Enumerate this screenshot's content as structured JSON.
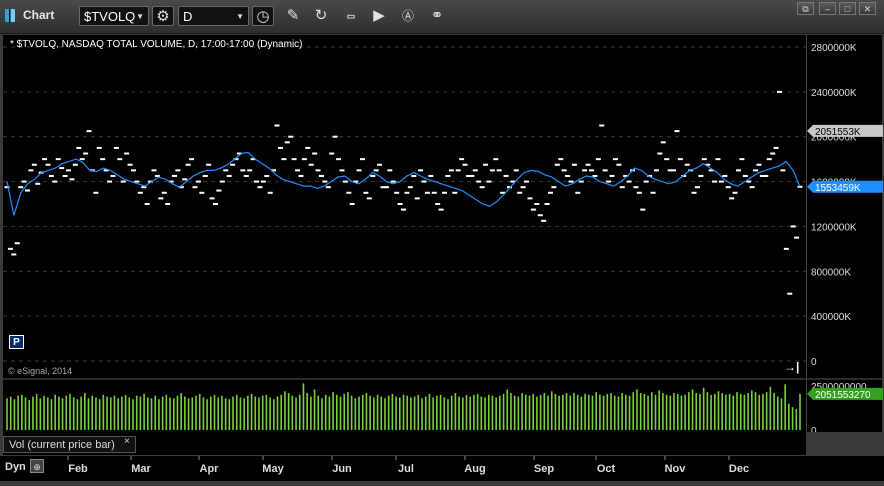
{
  "toolbar": {
    "app_title": "Chart",
    "symbol_value": "$TVOLQ",
    "interval_value": "D"
  },
  "chart_header": {
    "legend": "* $TVOLQ, NASDAQ TOTAL VOLUME, D, 17:00-17:00 (Dynamic)",
    "copyright": "© eSignal, 2014",
    "p_button": "P",
    "end_button": "→|"
  },
  "volume_study": {
    "label": "Vol (current price bar)",
    "close_label": "×"
  },
  "time_axis": {
    "dyn_label": "Dyn",
    "months": [
      "Feb",
      "Mar",
      "Apr",
      "May",
      "Jun",
      "Jul",
      "Aug",
      "Sep",
      "Oct",
      "Nov",
      "Dec"
    ]
  },
  "colors": {
    "background": "#000000",
    "price_marks": "#ffffff",
    "moving_average": "#1e90ff",
    "volume_bars": "#7cd03c",
    "last_price_tag": "#1e8fff",
    "ma_tag": "#c8c8c8",
    "volume_tag": "#33a020"
  },
  "chart_data": [
    {
      "type": "scatter",
      "title": "$TVOLQ, NASDAQ TOTAL VOLUME, D",
      "price_axis_ticks": [
        "2800000K",
        "2400000K",
        "2000000K",
        "1600000K",
        "1200000K",
        "800000K",
        "400000K",
        "0"
      ],
      "ylim": [
        0,
        2800000
      ],
      "grid": true,
      "last_value_tag": "1553459K",
      "ma_value_tag": "2051553K",
      "series": [
        {
          "values": [
            1550000,
            1000000,
            950000,
            1050000,
            1550000,
            1600000,
            1520000,
            1700000,
            1750000,
            1580000,
            1680000,
            1800000,
            1750000,
            1650000,
            1600000,
            1800000,
            1720000,
            1650000,
            1700000,
            1620000,
            1750000,
            1900000,
            1800000,
            1850000,
            2050000,
            1700000,
            1500000,
            1900000,
            1800000,
            1700000,
            1600000,
            1650000,
            1900000,
            1800000,
            1600000,
            1850000,
            1750000,
            1700000,
            1600000,
            1500000,
            1550000,
            1400000,
            1600000,
            1700000,
            1650000,
            1450000,
            1500000,
            1400000,
            1600000,
            1650000,
            1700000,
            1550000,
            1620000,
            1750000,
            1800000,
            1550000,
            1600000,
            1500000,
            1650000,
            1750000,
            1450000,
            1400000,
            1520000,
            1600000,
            1700000,
            1650000,
            1750000,
            1800000,
            1850000,
            1700000,
            1650000,
            1700000,
            1800000,
            1600000,
            1550000,
            1600000,
            1650000,
            1500000,
            1700000,
            2100000,
            1900000,
            1800000,
            1950000,
            2000000,
            1800000,
            1700000,
            1650000,
            1800000,
            1900000,
            1750000,
            1850000,
            1700000,
            1650000,
            1600000,
            1550000,
            1850000,
            2000000,
            1800000,
            1700000,
            1600000,
            1500000,
            1400000,
            1600000,
            1700000,
            1800000,
            1500000,
            1450000,
            1650000,
            1700000,
            1750000,
            1550000,
            1550000,
            1700000,
            1600000,
            1500000,
            1400000,
            1350000,
            1500000,
            1550000,
            1650000,
            1450000,
            1700000,
            1600000,
            1500000,
            1650000,
            1500000,
            1400000,
            1350000,
            1500000,
            1650000,
            1700000,
            1500000,
            1700000,
            1800000,
            1750000,
            1650000,
            1650000,
            1700000,
            1600000,
            1550000,
            1750000,
            1600000,
            1700000,
            1800000,
            1700000,
            1500000,
            1650000,
            1550000,
            1600000,
            1700000,
            1500000,
            1550000,
            1600000,
            1450000,
            1350000,
            1400000,
            1300000,
            1250000,
            1400000,
            1500000,
            1550000,
            1750000,
            1800000,
            1700000,
            1650000,
            1600000,
            1750000,
            1500000,
            1600000,
            1700000,
            1750000,
            1700000,
            1650000,
            1800000,
            2100000,
            1700000,
            1600000,
            1650000,
            1800000,
            1750000,
            1550000,
            1650000,
            1600000,
            1700000,
            1550000,
            1500000,
            1350000,
            1600000,
            1650000,
            1500000,
            1700000,
            1850000,
            1950000,
            1800000,
            1700000,
            1700000,
            2050000,
            1800000,
            1650000,
            1750000,
            1700000,
            1500000,
            1550000,
            1650000,
            1800000,
            1750000,
            1700000,
            1600000,
            1800000,
            1600000,
            1650000,
            1550000,
            1450000,
            1500000,
            1700000,
            1800000,
            1650000,
            1600000,
            1550000,
            1700000,
            1750000,
            1650000,
            1650000,
            1800000,
            1850000,
            1900000,
            2400000,
            1700000,
            1000000,
            600000,
            1200000,
            1100000,
            1553459
          ]
        },
        {
          "name": "Moving average",
          "values": [
            1600000,
            1300000,
            1500000,
            1580000,
            1620000,
            1680000,
            1700000,
            1720000,
            1760000,
            1780000,
            1800000,
            1770000,
            1700000,
            1690000,
            1720000,
            1700000,
            1660000,
            1620000,
            1600000,
            1580000,
            1560000,
            1600000,
            1640000,
            1620000,
            1580000,
            1550000,
            1600000,
            1650000,
            1680000,
            1700000,
            1700000,
            1720000,
            1750000,
            1800000,
            1850000,
            1860000,
            1800000,
            1760000,
            1720000,
            1660000,
            1620000,
            1600000,
            1580000,
            1560000,
            1560000,
            1540000,
            1560000,
            1600000,
            1640000,
            1650000,
            1600000,
            1580000,
            1620000,
            1680000,
            1650000,
            1600000,
            1580000,
            1600000,
            1650000,
            1680000,
            1650000,
            1620000,
            1600000,
            1580000,
            1560000,
            1540000,
            1520000,
            1480000,
            1440000,
            1400000,
            1380000,
            1420000,
            1480000,
            1550000,
            1620000,
            1680000,
            1700000,
            1690000,
            1660000,
            1640000,
            1600000,
            1560000,
            1580000,
            1620000,
            1650000,
            1640000,
            1600000,
            1580000,
            1560000,
            1600000,
            1650000,
            1720000,
            1700000,
            1650000,
            1620000,
            1600000,
            1580000,
            1600000,
            1650000,
            1700000,
            1720000,
            1760000,
            1720000,
            1680000,
            1620000,
            1580000,
            1560000,
            1600000,
            1640000,
            1680000,
            1700000,
            1720000,
            1740000,
            1780000,
            1700000,
            1553459
          ]
        }
      ]
    },
    {
      "type": "bar",
      "title": "Vol (current price bar)",
      "axis_ticks": [
        "2500000000",
        "0"
      ],
      "ylim": [
        0,
        2500000000
      ],
      "last_value_tag": "2051553270",
      "values": [
        1800000000,
        1900000000,
        1750000000,
        1950000000,
        2000000000,
        1850000000,
        1700000000,
        1900000000,
        2050000000,
        1800000000,
        1950000000,
        1850000000,
        1750000000,
        2000000000,
        1900000000,
        1800000000,
        1950000000,
        2050000000,
        1850000000,
        1750000000,
        1900000000,
        2100000000,
        1800000000,
        1950000000,
        1850000000,
        1750000000,
        2000000000,
        1900000000,
        1850000000,
        1950000000,
        1800000000,
        1900000000,
        2000000000,
        1850000000,
        1750000000,
        1950000000,
        1900000000,
        2050000000,
        1850000000,
        1800000000,
        1950000000,
        1750000000,
        1900000000,
        2000000000,
        1850000000,
        1800000000,
        1950000000,
        2100000000,
        1900000000,
        1800000000,
        1850000000,
        1950000000,
        2050000000,
        1850000000,
        1750000000,
        1900000000,
        2000000000,
        1850000000,
        1950000000,
        1800000000,
        1750000000,
        1900000000,
        2000000000,
        1850000000,
        1800000000,
        1950000000,
        2050000000,
        1900000000,
        1850000000,
        1950000000,
        2000000000,
        1850000000,
        1750000000,
        1900000000,
        2000000000,
        2200000000,
        2100000000,
        1950000000,
        1850000000,
        2000000000,
        2650000000,
        2100000000,
        1900000000,
        2300000000,
        1950000000,
        1800000000,
        2000000000,
        1900000000,
        2150000000,
        2000000000,
        1900000000,
        2050000000,
        2150000000,
        1950000000,
        1800000000,
        1900000000,
        2000000000,
        2100000000,
        1950000000,
        1850000000,
        2000000000,
        1900000000,
        1800000000,
        1950000000,
        2050000000,
        1900000000,
        1850000000,
        2000000000,
        1950000000,
        1850000000,
        1900000000,
        2000000000,
        1800000000,
        1900000000,
        2050000000,
        1850000000,
        1950000000,
        2000000000,
        1850000000,
        1750000000,
        1950000000,
        2100000000,
        1900000000,
        1850000000,
        2000000000,
        1900000000,
        2000000000,
        2050000000,
        1900000000,
        1850000000,
        2000000000,
        1950000000,
        1850000000,
        1950000000,
        2050000000,
        2300000000,
        2100000000,
        1950000000,
        1900000000,
        2100000000,
        2000000000,
        1950000000,
        2050000000,
        1900000000,
        2000000000,
        2100000000,
        1950000000,
        2200000000,
        2050000000,
        1950000000,
        2000000000,
        2100000000,
        1950000000,
        2100000000,
        2000000000,
        1900000000,
        2050000000,
        2000000000,
        1950000000,
        2150000000,
        2000000000,
        1950000000,
        2050000000,
        2100000000,
        1950000000,
        1900000000,
        2100000000,
        2000000000,
        1950000000,
        2150000000,
        2300000000,
        2100000000,
        2050000000,
        1950000000,
        2150000000,
        2000000000,
        2250000000,
        2100000000,
        2000000000,
        1950000000,
        2100000000,
        2050000000,
        1950000000,
        2000000000,
        2150000000,
        2300000000,
        2100000000,
        2050000000,
        2400000000,
        2150000000,
        2000000000,
        2050000000,
        2200000000,
        2100000000,
        2000000000,
        2050000000,
        1950000000,
        2150000000,
        2050000000,
        2000000000,
        2100000000,
        2250000000,
        2150000000,
        2000000000,
        2050000000,
        2150000000,
        2450000000,
        2100000000,
        1900000000,
        1800000000,
        2600000000,
        1500000000,
        1300000000,
        1200000000,
        2051553270
      ]
    }
  ]
}
